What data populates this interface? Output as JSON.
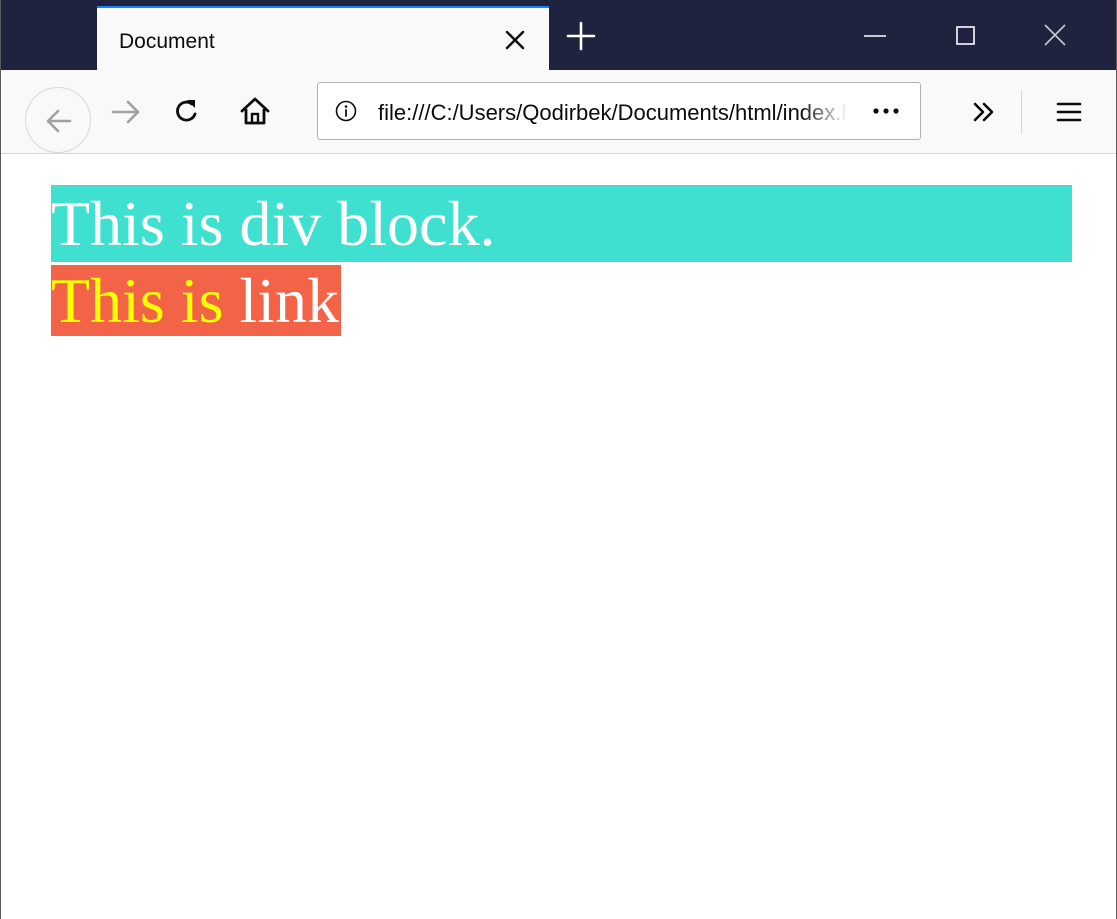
{
  "browser": {
    "tab": {
      "title": "Document"
    },
    "url": "file:///C:/Users/Qodirbek/Documents/html/index.html",
    "colors": {
      "titlebar": "#1f2340",
      "tab_accent": "#0a84ff",
      "toolbar": "#f9f9fa"
    }
  },
  "page": {
    "div_block": {
      "text": "This is div block.",
      "background": "#40e0d0",
      "color": "#ffffff"
    },
    "link": {
      "part1": "This is",
      "part2": "link",
      "background": "#f36347",
      "part1_color": "#ffff00",
      "part2_color": "#ffffff"
    }
  }
}
